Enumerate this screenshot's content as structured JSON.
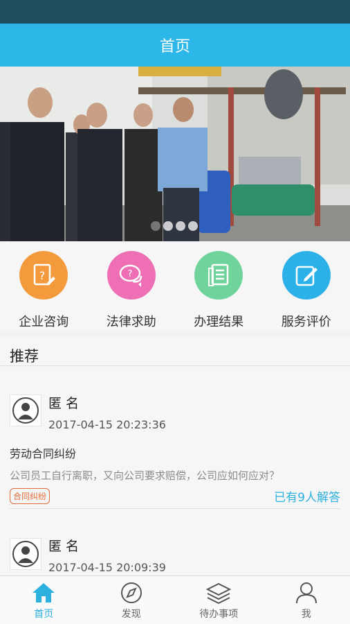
{
  "header": {
    "title": "首页"
  },
  "banner": {
    "slide_count": 4,
    "active_index": 0
  },
  "quick_menu": [
    {
      "label": "企业咨询",
      "icon": "question-doc-icon",
      "color": "#f39a3c"
    },
    {
      "label": "法律求助",
      "icon": "chat-question-icon",
      "color": "#ee6fb3"
    },
    {
      "label": "办理结果",
      "icon": "document-list-icon",
      "color": "#6fd39b"
    },
    {
      "label": "服务评价",
      "icon": "edit-icon",
      "color": "#2cb0e8"
    }
  ],
  "recommend": {
    "title": "推荐",
    "posts": [
      {
        "user": "匿 名",
        "time": "2017-04-15 20:23:36",
        "title": "劳动合同纠纷",
        "desc": "公司员工自行离职，又向公司要求赔偿，公司应如何应对？",
        "tag": "合同纠纷",
        "answers": "已有9人解答"
      },
      {
        "user": "匿 名",
        "time": "2017-04-15 20:09:39"
      }
    ]
  },
  "tabbar": {
    "items": [
      {
        "label": "首页",
        "icon": "home-icon",
        "active": true
      },
      {
        "label": "发现",
        "icon": "compass-icon",
        "active": false
      },
      {
        "label": "待办事项",
        "icon": "layers-icon",
        "active": false
      },
      {
        "label": "我",
        "icon": "user-icon",
        "active": false
      }
    ]
  },
  "colors": {
    "accent": "#2cb7e8",
    "status_bar": "#1f4e5f",
    "tag": "#e36a3a"
  }
}
